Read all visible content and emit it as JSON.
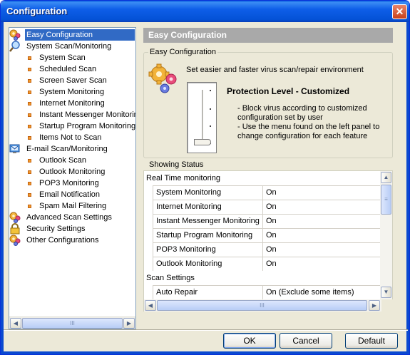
{
  "window": {
    "title": "Configuration",
    "close_glyph": "✕"
  },
  "tree": {
    "items": [
      {
        "label": "Easy Configuration",
        "level": 0,
        "icon": "gears-icon",
        "selected": true
      },
      {
        "label": "System Scan/Monitoring",
        "level": 0,
        "icon": "magnifier-icon"
      },
      {
        "label": "System Scan",
        "level": 1
      },
      {
        "label": "Scheduled Scan",
        "level": 1
      },
      {
        "label": "Screen Saver Scan",
        "level": 1
      },
      {
        "label": "System Monitoring",
        "level": 1
      },
      {
        "label": "Internet Monitoring",
        "level": 1
      },
      {
        "label": "Instant Messenger Monitoring",
        "level": 1
      },
      {
        "label": "Startup Program Monitoring",
        "level": 1
      },
      {
        "label": "Items Not to Scan",
        "level": 1
      },
      {
        "label": "E-mail Scan/Monitoring",
        "level": 0,
        "icon": "email-monitor-icon"
      },
      {
        "label": "Outlook Scan",
        "level": 1
      },
      {
        "label": "Outlook Monitoring",
        "level": 1
      },
      {
        "label": "POP3 Monitoring",
        "level": 1
      },
      {
        "label": "Email Notification",
        "level": 1
      },
      {
        "label": "Spam Mail Filtering",
        "level": 1
      },
      {
        "label": "Advanced Scan Settings",
        "level": 0,
        "icon": "advanced-gears-icon"
      },
      {
        "label": "Security Settings",
        "level": 0,
        "icon": "lock-icon"
      },
      {
        "label": "Other Configurations",
        "level": 0,
        "icon": "other-gears-icon"
      }
    ]
  },
  "panel": {
    "header": "Easy Configuration"
  },
  "easy_config": {
    "group_title": "Easy Configuration",
    "description": "Set easier and faster virus scan/repair environment",
    "protection_level": "Protection Level - Customized",
    "bullets": [
      "- Block virus according to customized",
      "configuration set by user",
      "- Use the menu found on the left panel to",
      "change configuration for each feature"
    ]
  },
  "status": {
    "group_title": "Showing Status",
    "sections": [
      {
        "title": "Real Time monitoring",
        "rows": [
          {
            "name": "System Monitoring",
            "value": "On"
          },
          {
            "name": "Internet Monitoring",
            "value": "On"
          },
          {
            "name": "Instant Messenger Monitoring",
            "value": "On"
          },
          {
            "name": "Startup Program Monitoring",
            "value": "On"
          },
          {
            "name": "POP3 Monitoring",
            "value": "On"
          },
          {
            "name": "Outlook Monitoring",
            "value": "On"
          }
        ]
      },
      {
        "title": "Scan Settings",
        "rows": [
          {
            "name": "Auto Repair",
            "value": "On (Exclude some items)"
          }
        ]
      }
    ]
  },
  "scroll_glyphs": {
    "left": "◀",
    "right": "▶",
    "up": "▲",
    "down": "▼",
    "grip_h": "III",
    "grip_v": "≡"
  },
  "buttons": {
    "ok": "OK",
    "cancel": "Cancel",
    "default": "Default"
  }
}
